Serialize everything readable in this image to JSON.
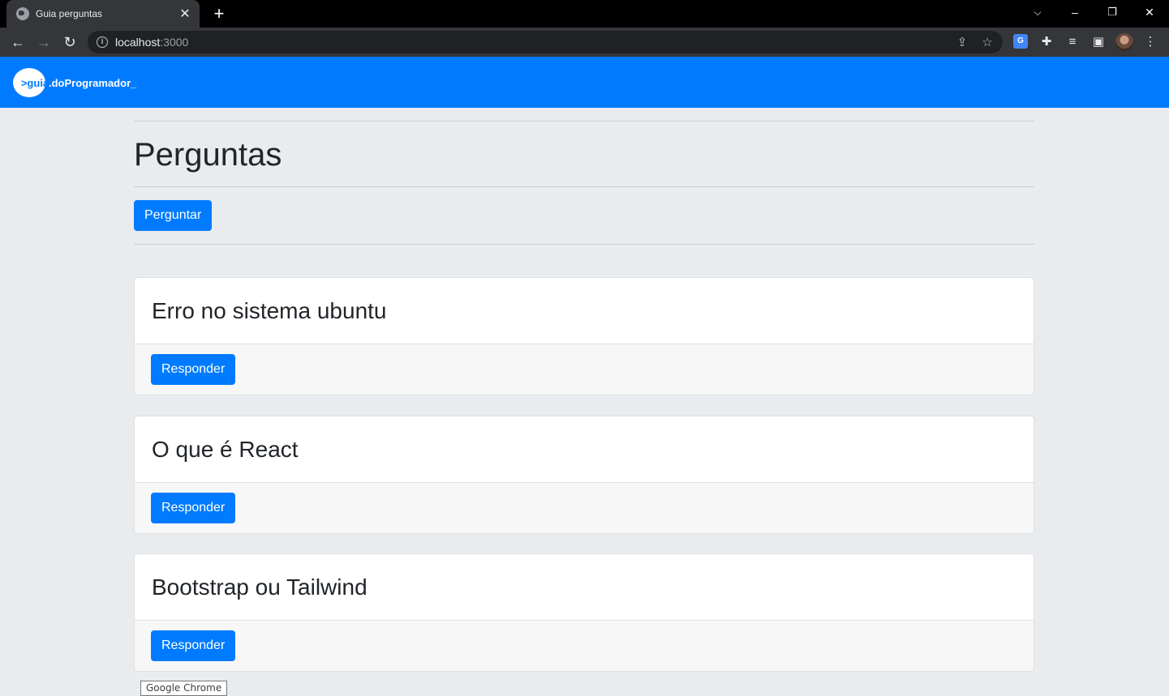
{
  "browser": {
    "tab_title": "Guia perguntas",
    "url_host": "localhost",
    "url_port": ":3000",
    "tooltip": "Google Chrome"
  },
  "site": {
    "logo_mark": ">guia",
    "logo_text": ".doProgramador_",
    "brand_color": "#007bff"
  },
  "page": {
    "title": "Perguntas",
    "ask_button": "Perguntar"
  },
  "questions": [
    {
      "title": "Erro no sistema ubuntu",
      "answer_button": "Responder"
    },
    {
      "title": "O que é React",
      "answer_button": "Responder"
    },
    {
      "title": "Bootstrap ou Tailwind",
      "answer_button": "Responder"
    }
  ]
}
